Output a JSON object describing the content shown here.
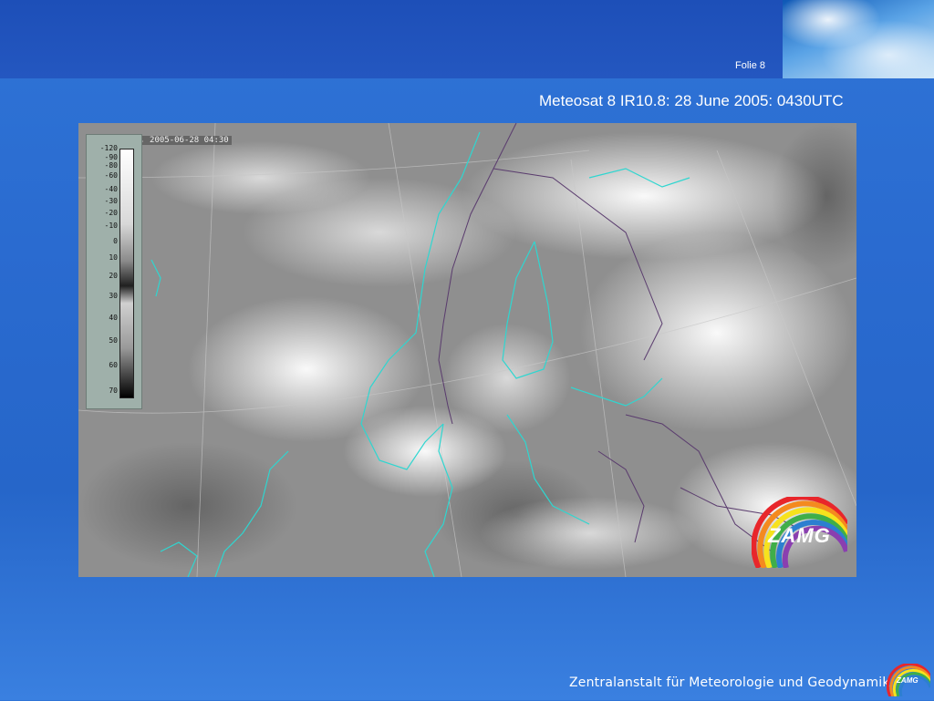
{
  "slide": {
    "number_label": "Folie 8",
    "title": "Meteosat 8 IR10.8: 28 June 2005: 0430UTC"
  },
  "satellite_image": {
    "header_text": "Sat: 1108B, 2005-06-28 04:30",
    "scale_ticks": [
      "-120",
      "-90",
      "-80",
      "-60",
      "-40",
      "-30",
      "-20",
      "-10",
      "0",
      "10",
      "20",
      "30",
      "40",
      "50",
      "60",
      "70"
    ],
    "coastline_color": "#2fd6d0",
    "border_color": "#5a3c6e"
  },
  "logo": {
    "text": "ZAMG"
  },
  "footer": {
    "organization": "Zentralanstalt für Meteorologie und Geodynamik",
    "logo_text": "ZAMG"
  }
}
